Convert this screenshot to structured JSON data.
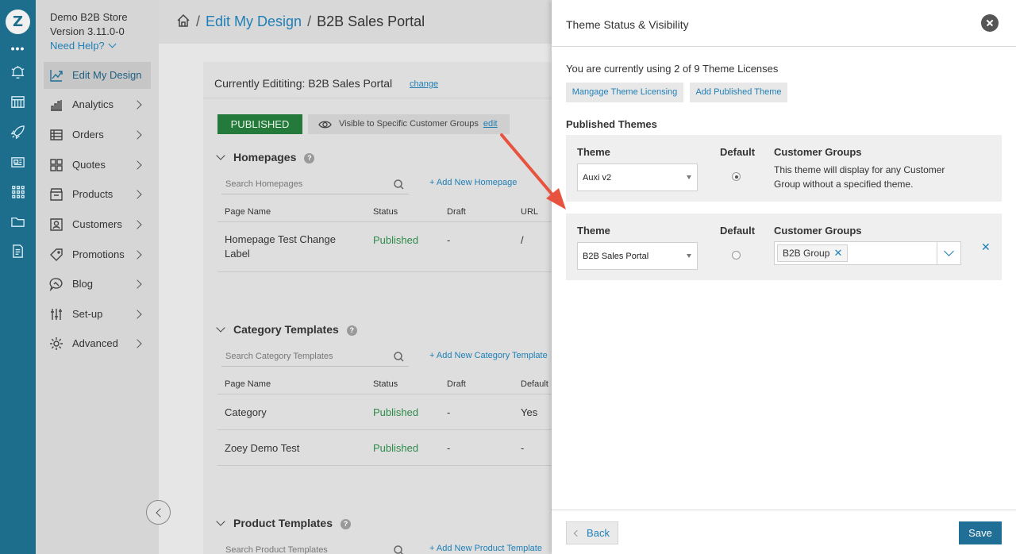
{
  "rail": {
    "logo": "Z",
    "more": "•••",
    "icons": [
      "alarm-icon",
      "storefront-icon",
      "rocket-icon",
      "newspaper-icon",
      "apps-grid-icon",
      "folder-icon",
      "document-icon"
    ]
  },
  "sidebar": {
    "store_name": "Demo B2B Store",
    "version": "Version 3.11.0-0",
    "help": "Need Help?",
    "items": [
      {
        "label": "Edit My Design",
        "icon": "design-chart-icon",
        "active": true
      },
      {
        "label": "Analytics",
        "icon": "bar-chart-icon"
      },
      {
        "label": "Orders",
        "icon": "orders-list-icon"
      },
      {
        "label": "Quotes",
        "icon": "quotes-grid-icon"
      },
      {
        "label": "Products",
        "icon": "products-box-icon"
      },
      {
        "label": "Customers",
        "icon": "customers-card-icon"
      },
      {
        "label": "Promotions",
        "icon": "tag-icon"
      },
      {
        "label": "Blog",
        "icon": "chat-bubble-icon"
      },
      {
        "label": "Set-up",
        "icon": "sliders-icon"
      },
      {
        "label": "Advanced",
        "icon": "gear-icon"
      }
    ]
  },
  "breadcrumb": {
    "section": "Edit My Design",
    "current": "B2B Sales Portal"
  },
  "editor": {
    "editing_label": "Currently Edititing: B2B Sales Portal",
    "change_link": "change",
    "status_badge": "PUBLISHED",
    "visibility_text": "Visible to Specific Customer Groups",
    "visibility_edit": "edit"
  },
  "homepages": {
    "title": "Homepages",
    "search_placeholder": "Search Homepages",
    "add_link": "+ Add New Homepage",
    "columns": [
      "Page Name",
      "Status",
      "Draft",
      "URL"
    ],
    "rows": [
      {
        "name": "Homepage Test Change Label",
        "status": "Published",
        "draft": "-",
        "url": "/"
      }
    ]
  },
  "category_templates": {
    "title": "Category Templates",
    "search_placeholder": "Search Category Templates",
    "add_link": "+ Add New Category Template",
    "columns": [
      "Page Name",
      "Status",
      "Draft",
      "Default"
    ],
    "rows": [
      {
        "name": "Category",
        "status": "Published",
        "draft": "-",
        "default": "Yes"
      },
      {
        "name": "Zoey Demo Test",
        "status": "Published",
        "draft": "-",
        "default": "-"
      }
    ]
  },
  "product_templates": {
    "title": "Product Templates",
    "search_placeholder": "Search Product Templates",
    "add_link": "+ Add New Product Template"
  },
  "panel": {
    "title": "Theme Status & Visibility",
    "license_text": "You are currently using 2 of 9 Theme Licenses",
    "manage_button": "Mangage Theme Licensing",
    "add_button": "Add Published Theme",
    "published_heading": "Published Themes",
    "col_theme": "Theme",
    "col_default": "Default",
    "col_groups": "Customer Groups",
    "rows": [
      {
        "theme": "Auxi v2",
        "default": true,
        "groups_text": "This theme will display for any Customer Group without a specified theme."
      },
      {
        "theme": "B2B Sales Portal",
        "default": false,
        "groups": [
          "B2B Group"
        ]
      }
    ],
    "back_button": "Back",
    "save_button": "Save"
  },
  "colors": {
    "rail": "#1d6d8c",
    "accent": "#1f7fb6",
    "published_green": "#247a3a",
    "arrow": "#e8533f"
  }
}
